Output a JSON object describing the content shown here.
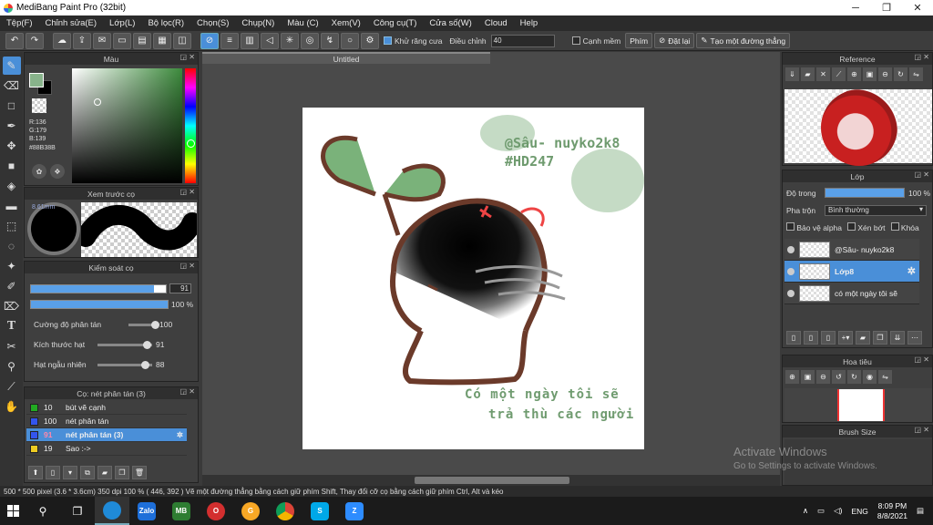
{
  "window": {
    "title": "MediBang Paint Pro (32bit)",
    "controls": [
      "─",
      "❐",
      "✕"
    ]
  },
  "menu": [
    "Tệp(F)",
    "Chỉnh sửa(E)",
    "Lớp(L)",
    "Bộ lọc(R)",
    "Chọn(S)",
    "Chụp(N)",
    "Màu (C)",
    "Xem(V)",
    "Công cụ(T)",
    "Cửa số(W)",
    "Cloud",
    "Help"
  ],
  "toolbar": {
    "antialias_label": "Khử răng cưa",
    "adjust_label": "Điều chỉnh",
    "adjust_value": "40",
    "canh_mem_label": "Cạnh mềm",
    "phim_label": "Phím",
    "reset_label": "Đặt lại",
    "straight_line_label": "Tạo một đường thẳng"
  },
  "color_panel": {
    "title": "Màu",
    "r": "R:136",
    "g": "G:179",
    "b": "B:139",
    "hex": "#88B38B",
    "fg_color": "#88b38b"
  },
  "preview_panel": {
    "title": "Xem trước cọ",
    "size": "8.61mm"
  },
  "brush_control": {
    "title": "Kiểm soát cọ",
    "size_value": "91",
    "size_fraction": 0.91,
    "opacity_value": "100 %",
    "opacity_fraction": 1.0,
    "params": [
      {
        "label": "Cường độ phân tán",
        "value": "100",
        "level": 1.0
      },
      {
        "label": "Kích thước hạt",
        "value": "91",
        "level": 0.91
      },
      {
        "label": "Hạt ngẫu nhiên",
        "value": "88",
        "level": 0.88
      }
    ]
  },
  "brush_panel": {
    "title": "Cọ: nét phân tán (3)",
    "items": [
      {
        "size": "10",
        "name": "bút vẽ cạnh",
        "color": "#22aa22"
      },
      {
        "size": "100",
        "name": "nét phân tán",
        "color": "#3355ee"
      },
      {
        "size": "91",
        "name": "nét phân tán (3)",
        "color": "#3355ee"
      },
      {
        "size": "19",
        "name": "Sao :->",
        "color": "#eecc22"
      }
    ]
  },
  "canvas": {
    "tab_title": "Untitled",
    "watermark_name": "@Sâu- nuyko2k8",
    "watermark_tag": "#HD247",
    "caption_line1": "Có một ngày tôi sẽ",
    "caption_line2": "trả thù các người"
  },
  "reference_panel": {
    "title": "Reference"
  },
  "layer_panel": {
    "title": "Lớp",
    "opacity_label": "Độ trong",
    "opacity_value": "100 %",
    "blend_label": "Pha trộn",
    "blend_value": "Bình thường",
    "protect_alpha": "Bảo vệ alpha",
    "clip": "Xén bớt",
    "lock": "Khóa",
    "layers": [
      {
        "name": "@Sâu- nuyko2k8"
      },
      {
        "name": "Lớp8"
      },
      {
        "name": "có một ngày tôi sẽ"
      }
    ]
  },
  "navigator_panel": {
    "title": "Hoa tiêu"
  },
  "brush_size_panel": {
    "title": "Brush Size"
  },
  "status": "500 * 500 pixel  (3.6 * 3.6cm)  350 dpi  100 %  ( 446, 392 )  Vẽ một đường thẳng bằng cách giữ phím Shift, Thay đổi cỡ cọ bằng cách giữ phím Ctrl, Alt và kéo",
  "activate": {
    "line1": "Activate Windows",
    "line2": "Go to Settings to activate Windows."
  },
  "taskbar": {
    "lang": "ENG",
    "time": "8:09 PM",
    "date": "8/8/2021",
    "apps": [
      {
        "label": "Zalo",
        "color": "#1e6fd9"
      },
      {
        "label": "MB",
        "color": "#2e7d32"
      },
      {
        "label": "O",
        "color": "#d32f2f"
      },
      {
        "label": "G",
        "color": "#f9a825"
      },
      {
        "label": "S",
        "color": "#00a8e8"
      },
      {
        "label": "Z",
        "color": "#2d8cff"
      }
    ]
  }
}
